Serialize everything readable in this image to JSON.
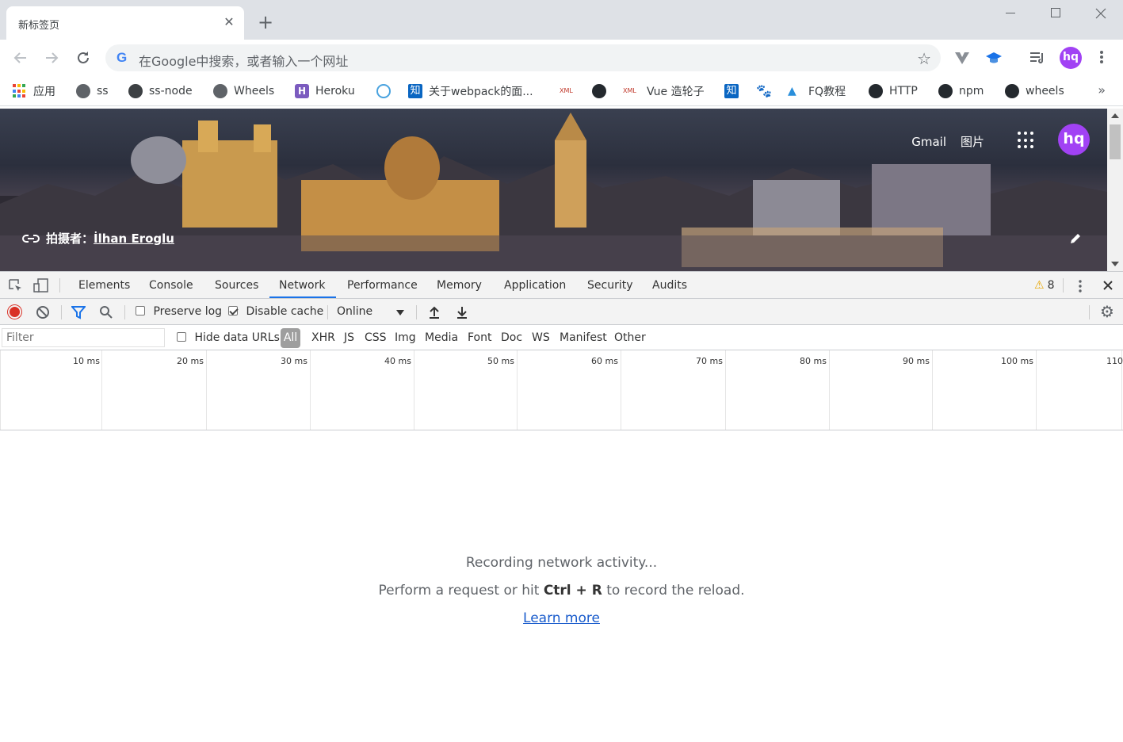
{
  "tab": {
    "title": "新标签页",
    "close_glyph": "✕",
    "new_tab_glyph": "+"
  },
  "omnibox": {
    "placeholder": "在Google中搜索，或者输入一个网址",
    "logo": "G"
  },
  "profile": {
    "initials": "hq",
    "color": "#a142f4"
  },
  "bookmarks": [
    {
      "label": "应用",
      "icon": "apps-icon"
    },
    {
      "label": "ss",
      "icon": "globe-icon"
    },
    {
      "label": "ss-node",
      "icon": "telegram-icon"
    },
    {
      "label": "Wheels",
      "icon": "globe-icon"
    },
    {
      "label": "Heroku",
      "icon": "heroku-icon"
    },
    {
      "label": "",
      "icon": "cloud-icon"
    },
    {
      "label": "关于webpack的面...",
      "icon": "zhihu-icon"
    },
    {
      "label": "",
      "icon": "xml-icon"
    },
    {
      "label": "",
      "icon": "github-icon"
    },
    {
      "label": "Vue 造轮子",
      "icon": "xml-icon"
    },
    {
      "label": "",
      "icon": "zhihu-icon"
    },
    {
      "label": "",
      "icon": "baidu-paw-icon"
    },
    {
      "label": "FQ教程",
      "icon": "fq-icon"
    },
    {
      "label": "HTTP",
      "icon": "github-icon"
    },
    {
      "label": "npm",
      "icon": "github-icon"
    },
    {
      "label": "wheels",
      "icon": "github-icon"
    }
  ],
  "bookmarks_more": "»",
  "page": {
    "gmail": "Gmail",
    "images": "图片",
    "photographer_prefix": "拍摄者：",
    "photographer_name": "İlhan Eroglu"
  },
  "devtools": {
    "tabs": [
      "Elements",
      "Console",
      "Sources",
      "Network",
      "Performance",
      "Memory",
      "Application",
      "Security",
      "Audits"
    ],
    "active_tab": "Network",
    "warning_count": "8",
    "toolbar": {
      "preserve_log": "Preserve log",
      "preserve_log_checked": false,
      "disable_cache": "Disable cache",
      "disable_cache_checked": true,
      "throttling": "Online"
    },
    "filter": {
      "placeholder": "Filter",
      "hide_data_urls": "Hide data URLs",
      "types": [
        "All",
        "XHR",
        "JS",
        "CSS",
        "Img",
        "Media",
        "Font",
        "Doc",
        "WS",
        "Manifest",
        "Other"
      ],
      "active_type": "All"
    },
    "timeline_ticks": [
      "10 ms",
      "20 ms",
      "30 ms",
      "40 ms",
      "50 ms",
      "60 ms",
      "70 ms",
      "80 ms",
      "90 ms",
      "100 ms",
      "110"
    ],
    "empty_state": {
      "line1": "Recording network activity...",
      "line2_prefix": "Perform a request or hit ",
      "line2_keys": "Ctrl + R",
      "line2_suffix": " to record the reload.",
      "link": "Learn more"
    },
    "colors": {
      "accent": "#1a73e8",
      "record": "#d93025",
      "warning": "#e8a600"
    }
  }
}
